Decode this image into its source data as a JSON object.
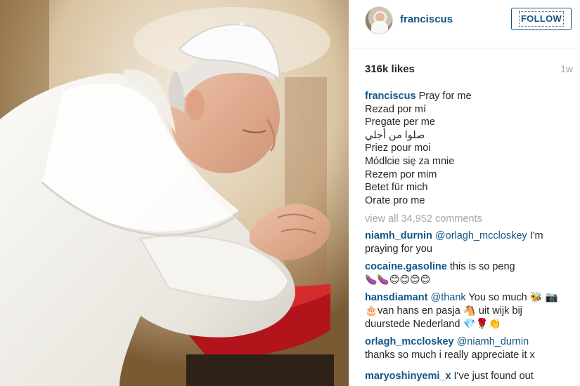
{
  "post": {
    "username": "franciscus",
    "follow_label": "FOLLOW",
    "likes": "316k likes",
    "age": "1w",
    "caption_user": "franciscus",
    "caption_lines": [
      "Pray for me",
      "Rezad por mí",
      "Pregate per me",
      "صلوا من أجلي",
      "Priez pour moi",
      "Módlcie się za mnie",
      "Rezem por mim",
      "Betet für mich",
      "Orate pro me"
    ],
    "view_all": "view all 34,952 comments"
  },
  "comments": [
    {
      "user": "niamh_durnin",
      "mention": "@orlagh_mccloskey",
      "text": " I'm",
      "line2": "praying for you"
    },
    {
      "user": "cocaine.gasoline",
      "text": " this is so peng",
      "emojis": "🍆🍆😊😊😊😊"
    },
    {
      "user": "hansdiamant",
      "mention": "@thank",
      "text": " You so much 🐝 📷",
      "line2": "🎂van hans en pasja 🐴 uit wijk bij",
      "line3": "duurstede Nederland 💎🌹👏"
    },
    {
      "user": "orlagh_mccloskey",
      "mention": "@niamh_durnin",
      "line2": "thanks so much i really appreciate it x"
    },
    {
      "user": "maryoshinyemi_x",
      "text": " I've just found out"
    }
  ],
  "photo": {
    "subject": "figure-in-white-robe-praying"
  }
}
